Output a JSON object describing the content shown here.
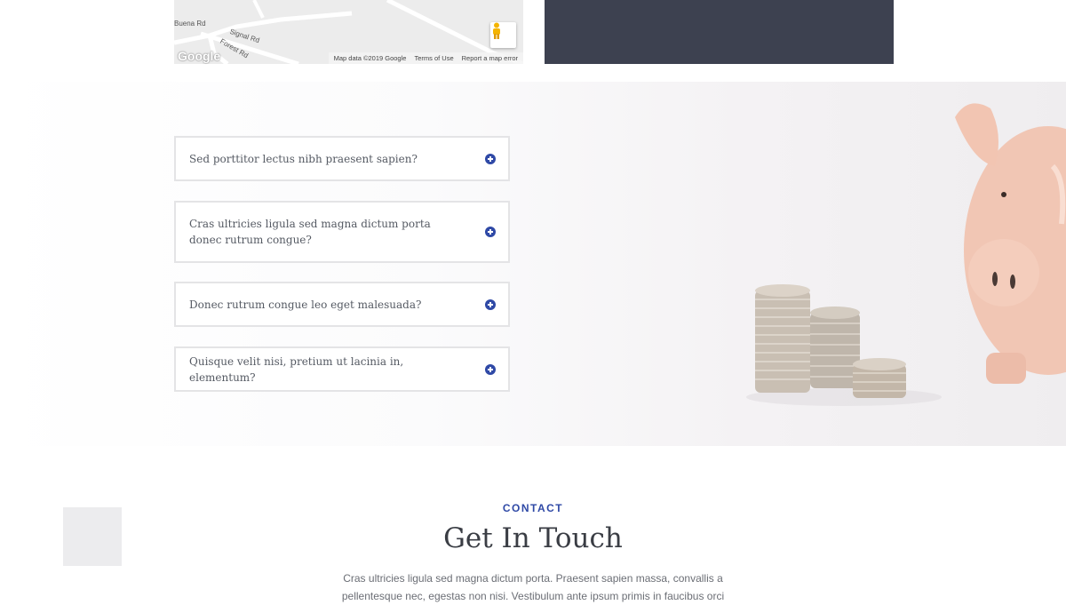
{
  "map": {
    "streets": [
      "Buena Rd",
      "Signal Rd",
      "Forest Rd"
    ],
    "logo": "Google",
    "footer": {
      "map_data": "Map data ©2019 Google",
      "terms": "Terms of Use",
      "report": "Report a map error"
    }
  },
  "faq": {
    "items": [
      {
        "question": "Sed porttitor lectus nibh praesent sapien?"
      },
      {
        "question": "Cras ultricies ligula sed magna dictum porta donec rutrum congue?"
      },
      {
        "question": "Donec rutrum congue leo eget malesuada?"
      },
      {
        "question": "Quisque velit nisi, pretium ut lacinia in, elementum?"
      }
    ]
  },
  "contact": {
    "eyebrow": "CONTACT",
    "title": "Get In Touch",
    "body": "Cras ultricies ligula sed magna dictum porta. Praesent sapien massa, convallis a pellentesque nec, egestas non nisi. Vestibulum ante ipsum primis in faucibus orci"
  },
  "colors": {
    "accent": "#2f49a6",
    "dark_panel": "#3d4150",
    "border": "#e4e4e6"
  }
}
